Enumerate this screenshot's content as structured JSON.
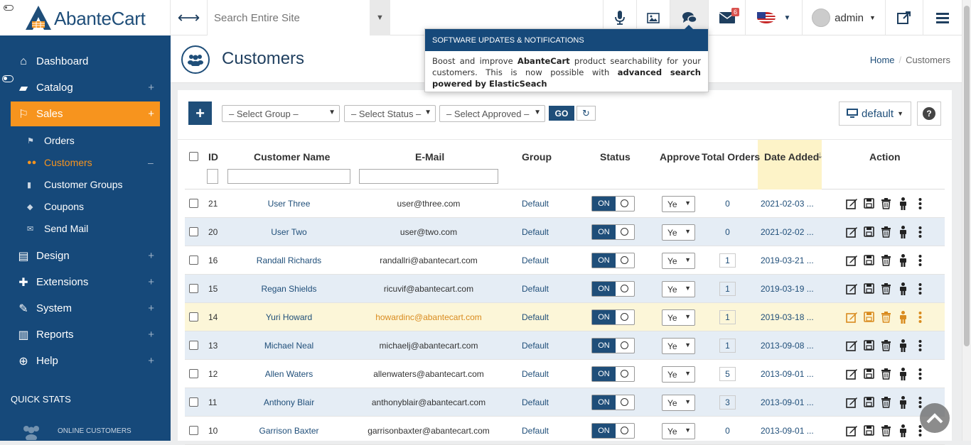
{
  "app": {
    "logo_text": "AbanteCart"
  },
  "topbar": {
    "search_placeholder": "Search Entire Site",
    "messages_badge": "6",
    "admin_name": "admin"
  },
  "sidebar": {
    "items": [
      {
        "label": "Dashboard",
        "icon": "home-icon"
      },
      {
        "label": "Catalog",
        "icon": "folder-icon"
      },
      {
        "label": "Sales",
        "icon": "flag-icon"
      },
      {
        "label": "Design",
        "icon": "file-icon"
      },
      {
        "label": "Extensions",
        "icon": "puzzle-icon"
      },
      {
        "label": "System",
        "icon": "wrench-icon"
      },
      {
        "label": "Reports",
        "icon": "bar-chart-icon"
      },
      {
        "label": "Help",
        "icon": "lifebuoy-icon"
      }
    ],
    "sales_sub": [
      {
        "label": "Orders"
      },
      {
        "label": "Customers"
      },
      {
        "label": "Customer Groups"
      },
      {
        "label": "Coupons"
      },
      {
        "label": "Send Mail"
      }
    ],
    "quick_stats": "QUICK STATS",
    "online_customers": "ONLINE CUSTOMERS"
  },
  "header": {
    "title": "Customers",
    "breadcrumb": [
      "Home",
      "Customers"
    ]
  },
  "toolbar": {
    "select_group": "– Select Group –",
    "select_status": "– Select Status –",
    "select_approved": "– Select Approved –",
    "go": "GO",
    "view": "default"
  },
  "table": {
    "columns": [
      "ID",
      "Customer Name",
      "E-Mail",
      "Group",
      "Status",
      "Approve",
      "Total Orders",
      "Date Added",
      "Action"
    ],
    "on_label": "ON",
    "approved_label": "Ye",
    "rows": [
      {
        "id": "21",
        "name": "User Three",
        "email": "user@three.com",
        "group": "Default",
        "orders": "0",
        "date": "2021-02-03 ..."
      },
      {
        "id": "20",
        "name": "User Two",
        "email": "user@two.com",
        "group": "Default",
        "orders": "0",
        "date": "2021-02-02 ..."
      },
      {
        "id": "16",
        "name": "Randall Richards",
        "email": "randallri@abantecart.com",
        "group": "Default",
        "orders": "1",
        "date": "2019-03-21 ..."
      },
      {
        "id": "15",
        "name": "Regan Shields",
        "email": "ricuvif@abantecart.com",
        "group": "Default",
        "orders": "1",
        "date": "2019-03-19 ..."
      },
      {
        "id": "14",
        "name": "Yuri Howard",
        "email": "howardinc@abantecart.com",
        "group": "Default",
        "orders": "1",
        "date": "2019-03-18 ..."
      },
      {
        "id": "13",
        "name": "Michael Neal",
        "email": "michaelj@abantecart.com",
        "group": "Default",
        "orders": "1",
        "date": "2013-09-08 ..."
      },
      {
        "id": "12",
        "name": "Allen Waters",
        "email": "allenwaters@abantecart.com",
        "group": "Default",
        "orders": "5",
        "date": "2013-09-01 ..."
      },
      {
        "id": "11",
        "name": "Anthony Blair",
        "email": "anthonyblair@abantecart.com",
        "group": "Default",
        "orders": "3",
        "date": "2013-09-01 ..."
      },
      {
        "id": "10",
        "name": "Garrison Baxter",
        "email": "garrisonbaxter@abantecart.com",
        "group": "Default",
        "orders": "0",
        "date": "2013-09-01 ..."
      }
    ]
  },
  "popup": {
    "title": "SOFTWARE UPDATES & NOTIFICATIONS",
    "text_1": "Boost and improve ",
    "brand": "AbanteCart",
    "text_2": " product searchability for your customers. This is now possible with ",
    "link": "advanced search powered by ElasticSeach"
  }
}
